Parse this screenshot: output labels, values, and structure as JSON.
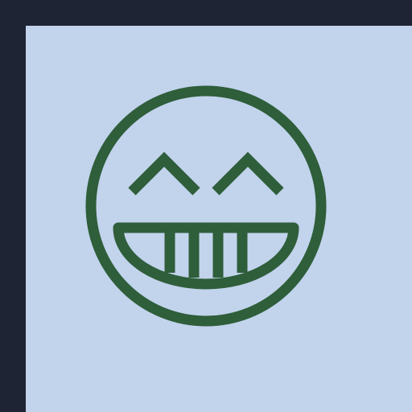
{
  "colors": {
    "frame": "#1e2433",
    "panel": "#c2d3ec",
    "icon": "#2e5e3a"
  },
  "icon": {
    "name": "grinning-squinting-face-icon"
  }
}
